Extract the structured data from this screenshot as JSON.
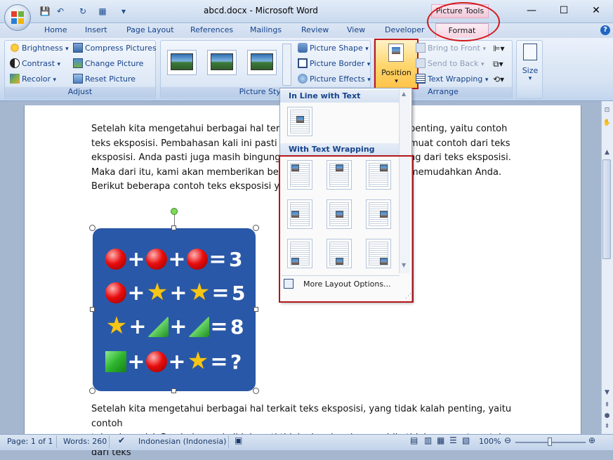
{
  "window": {
    "title": "abcd.docx - Microsoft Word",
    "context_tab": "Picture Tools",
    "controls": {
      "minimize": "—",
      "maximize": "☐",
      "close": "✕"
    }
  },
  "quick_access": {
    "save": "💾",
    "undo": "↶",
    "redo": "↻",
    "extra": "▦",
    "customize": "▾"
  },
  "tabs": [
    "Home",
    "Insert",
    "Page Layout",
    "References",
    "Mailings",
    "Review",
    "View",
    "Developer"
  ],
  "active_tab": "Format",
  "ribbon": {
    "adjust": {
      "label": "Adjust",
      "brightness": "Brightness",
      "contrast": "Contrast",
      "recolor": "Recolor",
      "compress": "Compress Pictures",
      "change": "Change Picture",
      "reset": "Reset Picture"
    },
    "picture_styles": {
      "label": "Picture Styles",
      "shape": "Picture Shape",
      "border": "Picture Border",
      "effects": "Picture Effects"
    },
    "arrange": {
      "label": "Arrange",
      "position": "Position",
      "bring_front": "Bring to Front",
      "send_back": "Send to Back",
      "text_wrapping": "Text Wrapping"
    },
    "size": {
      "label": "Size"
    }
  },
  "document": {
    "para1": "Setelah kita mengetahui berbagai hal terkait teks eksposisi, yang tidak kalah penting, yaitu contoh teks eksposisi. Pembahasan kali ini pasti tidak akan lengkap apabila tidak memuat contoh dari teks eksposisi. Anda pasti juga masih bingung apa saja yang dapat dijadikan contoh yang dari teks eksposisi. Maka dari itu, kami akan memberikan beberapa contoh teks eksposisi untuk memudahkan Anda. Berikut beberapa contoh teks eksposisi yang dapat Anda lihat:",
    "para1_lines": [
      "Setelah kita mengetahui berbagai hal terkait t",
      "teks eksposisi. Pembahasan kali ini pasti tidak",
      "eksposisi. Anda pasti juga masih bingung apa",
      "Maka dari itu, kami akan memberikan bebe",
      "Berikut beberapa contoh teks eksposisi yang"
    ],
    "para1_right": [
      "penting, yaitu contoh",
      "muat contoh dari teks",
      "ng dari teks eksposisi.",
      "memudahkan Anda.",
      ""
    ],
    "para2_lines": [
      "Setelah kita mengetahui berbagai hal terkait teks eksposisi, yang tidak kalah  penting, yaitu contoh",
      "teks eksposisi. Pembahasan kali ini pasti tidak akan lengkap apabila tidak memuat contoh dari teks"
    ],
    "puzzle": {
      "rows": [
        {
          "items": [
            "ball",
            "ball",
            "ball"
          ],
          "result": "3"
        },
        {
          "items": [
            "ball",
            "star",
            "star"
          ],
          "result": "5"
        },
        {
          "items": [
            "star",
            "square",
            "square"
          ],
          "result": "8"
        },
        {
          "items": [
            "square",
            "ball",
            "star"
          ],
          "result": "?"
        }
      ],
      "plus": "+",
      "equals": "="
    }
  },
  "dropdown": {
    "inline_header": "In Line with Text",
    "wrapping_header": "With Text Wrapping",
    "more": "More Layout Options..."
  },
  "statusbar": {
    "page": "Page: 1 of 1",
    "words": "Words: 260",
    "language": "Indonesian (Indonesia)",
    "zoom": "100%"
  },
  "colors": {
    "accent_red": "#c0161a",
    "puzzle_bg": "#2a58a8",
    "ribbon_text": "#15428b"
  }
}
